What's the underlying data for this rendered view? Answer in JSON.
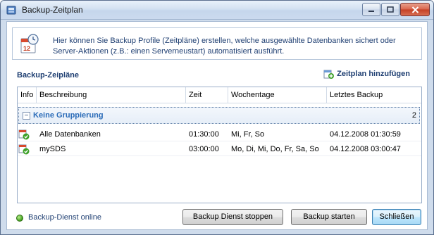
{
  "window": {
    "title": "Backup-Zeitplan",
    "icon": "backup-app-icon"
  },
  "info": {
    "icon": "calendar-clock-icon",
    "text": "Hier können Sie Backup Profile (Zeitpläne) erstellen, welche ausgewählte Datenbanken sichert oder Server-Aktionen (z.B.: einen Serverneustart) automatisiert ausführt."
  },
  "section": {
    "title": "Backup-Zeipläne",
    "add_label": "Zeitplan hinzufügen",
    "add_icon": "add-schedule-icon"
  },
  "grid": {
    "columns": [
      "Info",
      "Beschreibung",
      "Zeit",
      "Wochentage",
      "Letztes Backup"
    ],
    "group": {
      "toggle": "−",
      "label": "Keine Gruppierung",
      "count": "2"
    },
    "rows": [
      {
        "icon": "schedule-ok-icon",
        "description": "Alle Datenbanken",
        "time": "01:30:00",
        "weekdays": "Mi, Fr, So",
        "last_backup": "04.12.2008 01:30:59"
      },
      {
        "icon": "schedule-ok-icon",
        "description": "mySDS",
        "time": "03:00:00",
        "weekdays": "Mo, Di, Mi, Do, Fr, Sa, So",
        "last_backup": "04.12.2008 03:00:47"
      }
    ]
  },
  "status": {
    "text": "Backup-Dienst online",
    "color": "#3f9d1e"
  },
  "buttons": {
    "stop_service": "Backup Dienst stoppen",
    "start_backup": "Backup starten",
    "close": "Schließen"
  },
  "colors": {
    "accent_text": "#1f3f72",
    "group_text": "#2a6bb8",
    "title_bar": "#d3e1f1"
  }
}
